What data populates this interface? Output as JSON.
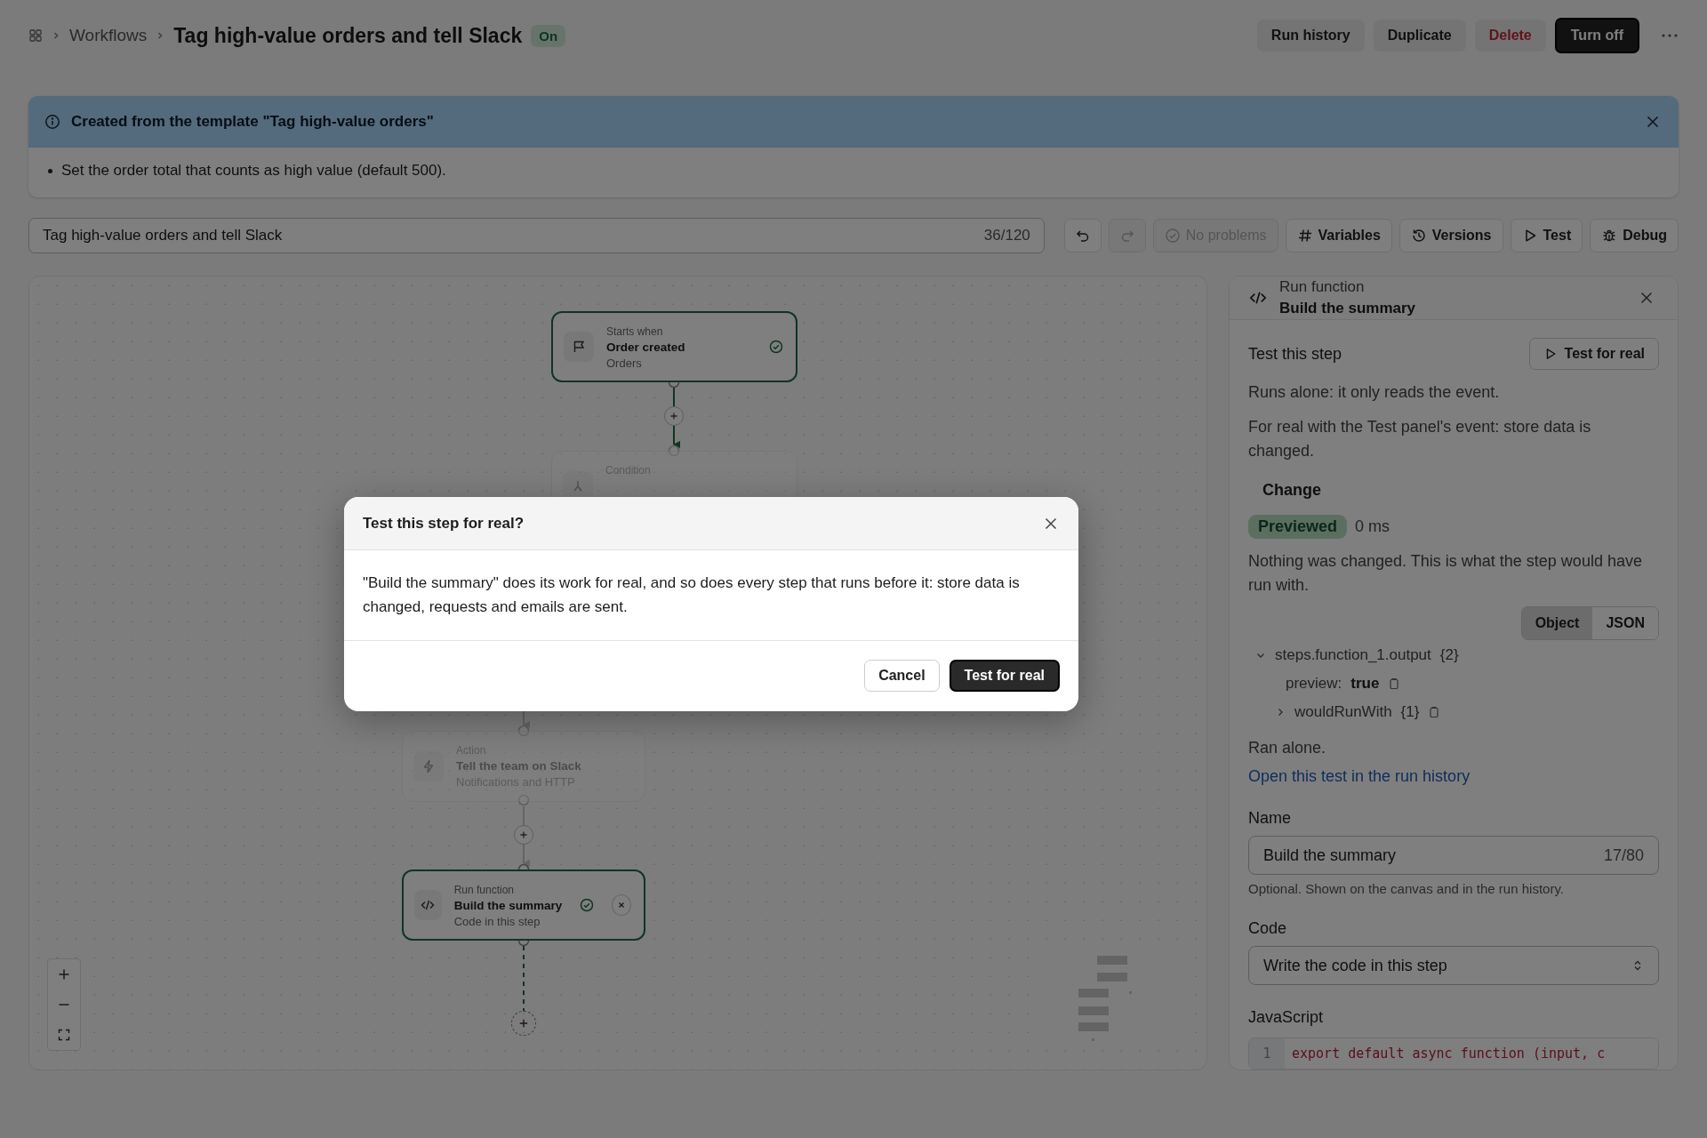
{
  "breadcrumb": {
    "parent": "Workflows",
    "title": "Tag high-value orders and tell Slack",
    "status": "On"
  },
  "header_actions": [
    {
      "label": "Run history",
      "kind": "default"
    },
    {
      "label": "Duplicate",
      "kind": "default"
    },
    {
      "label": "Delete",
      "kind": "danger"
    },
    {
      "label": "Turn off",
      "kind": "primary"
    }
  ],
  "notice": {
    "title": "Created from the template \"Tag high-value orders\"",
    "items": [
      "Set the order total that counts as high value (default 500)."
    ]
  },
  "name_field": {
    "value": "Tag high-value orders and tell Slack",
    "counter": "36/120"
  },
  "toolbar": [
    {
      "kind": "undo",
      "disabled": false
    },
    {
      "kind": "redo",
      "disabled": true
    },
    {
      "kind": "status",
      "label": "No problems",
      "disabled": true
    },
    {
      "kind": "variables",
      "label": "Variables",
      "disabled": false
    },
    {
      "kind": "versions",
      "label": "Versions",
      "disabled": false
    },
    {
      "kind": "test",
      "label": "Test",
      "disabled": false
    },
    {
      "kind": "debug",
      "label": "Debug",
      "disabled": false
    }
  ],
  "canvas": {
    "nodes": [
      {
        "kind": "trigger",
        "caption": "Starts when",
        "title": "Order created",
        "subtitle": "Orders",
        "passed": true,
        "dimmed": false,
        "selected": false
      },
      {
        "kind": "condition",
        "caption": "Condition",
        "passed": false,
        "dimmed": true,
        "selected": false
      },
      {
        "kind": "action",
        "caption": "Action",
        "title": "Tell the team on Slack",
        "subtitle": "Notifications and HTTP",
        "passed": false,
        "dimmed": true,
        "selected": false
      },
      {
        "kind": "function",
        "caption": "Run function",
        "title": "Build the summary",
        "subtitle": "Code in this step",
        "passed": true,
        "dimmed": false,
        "selected": true
      }
    ]
  },
  "panel": {
    "type": "Run function",
    "title": "Build the summary",
    "test": {
      "heading": "Test this step",
      "button": "Test for real",
      "notes": [
        "Runs alone: it only reads the event.",
        "For real with the Test panel's event: store data is changed."
      ]
    },
    "change": {
      "heading": "Change",
      "badge": "Previewed",
      "duration": "0 ms",
      "message": "Nothing was changed. This is what the step would have run with.",
      "views": [
        {
          "label": "Object",
          "selected": true
        },
        {
          "label": "JSON",
          "selected": false
        }
      ],
      "tree": [
        {
          "key": "steps.function_1.output",
          "count": "{2}",
          "expanded": true,
          "children": [
            {
              "key": "preview:",
              "value": "true"
            },
            {
              "key": "wouldRunWith",
              "count": "{1}",
              "expanded": false
            }
          ]
        }
      ],
      "footer": "Ran alone.",
      "link": "Open this test in the run history"
    },
    "name": {
      "label": "Name",
      "value": "Build the summary",
      "counter": "17/80",
      "help": "Optional. Shown on the canvas and in the run history."
    },
    "code": {
      "label": "Code",
      "value": "Write the code in this step"
    },
    "editor": {
      "label": "JavaScript",
      "line": "1",
      "text": "export default async function (input, c"
    }
  },
  "modal": {
    "title": "Test this step for real?",
    "message": "\"Build the summary\" does its work for real, and so does every step that runs before it: store data is changed, requests and emails are sent.",
    "actions": [
      {
        "label": "Cancel",
        "kind": "secondary"
      },
      {
        "label": "Test for real",
        "kind": "primary"
      }
    ]
  }
}
